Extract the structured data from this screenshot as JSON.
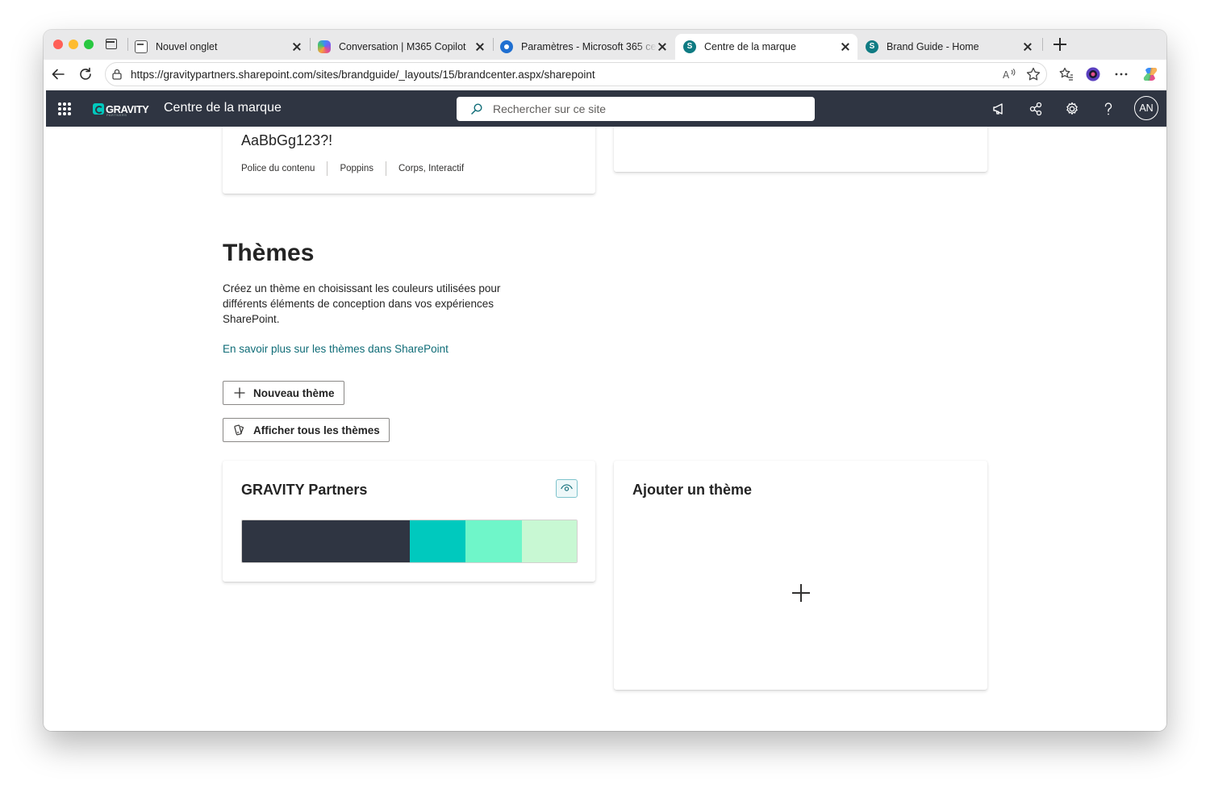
{
  "browser": {
    "tabs": [
      {
        "title": "Nouvel onglet",
        "icon": "new-tab-icon",
        "active": false
      },
      {
        "title": "Conversation | M365 Copilot",
        "icon": "copilot-icon",
        "active": false
      },
      {
        "title": "Paramètres - Microsoft 365 cen",
        "icon": "admin-center-icon",
        "active": false
      },
      {
        "title": "Centre de la marque",
        "icon": "sharepoint-icon",
        "active": true
      },
      {
        "title": "Brand Guide - Home",
        "icon": "sharepoint-icon",
        "active": false
      }
    ],
    "url": "https://gravitypartners.sharepoint.com/sites/brandguide/_layouts/15/brandcenter.aspx/sharepoint"
  },
  "suite": {
    "logo_text": "GRAVITY",
    "logo_sub": "PARTNERS",
    "site_name": "Centre de la marque",
    "search_placeholder": "Rechercher sur ce site",
    "avatar_initials": "AN"
  },
  "font_card": {
    "sample": "AaBbGg123?!",
    "meta": [
      "Police du contenu",
      "Poppins",
      "Corps, Interactif"
    ]
  },
  "themes": {
    "heading": "Thèmes",
    "description": "Créez un thème en choisissant les couleurs utilisées pour différents éléments de conception dans vos expériences SharePoint.",
    "learn_more": "En savoir plus sur les thèmes dans SharePoint",
    "new_theme_label": "Nouveau thème",
    "view_all_label": "Afficher tous les thèmes",
    "theme_card": {
      "name": "GRAVITY Partners",
      "swatches": [
        "#2f3542",
        "#00c9be",
        "#6ff6c9",
        "#c8f8d3"
      ]
    },
    "add_card": {
      "title": "Ajouter un thème"
    }
  },
  "colors": {
    "suite_bar": "#2f3542",
    "accent": "#0f6c77"
  }
}
